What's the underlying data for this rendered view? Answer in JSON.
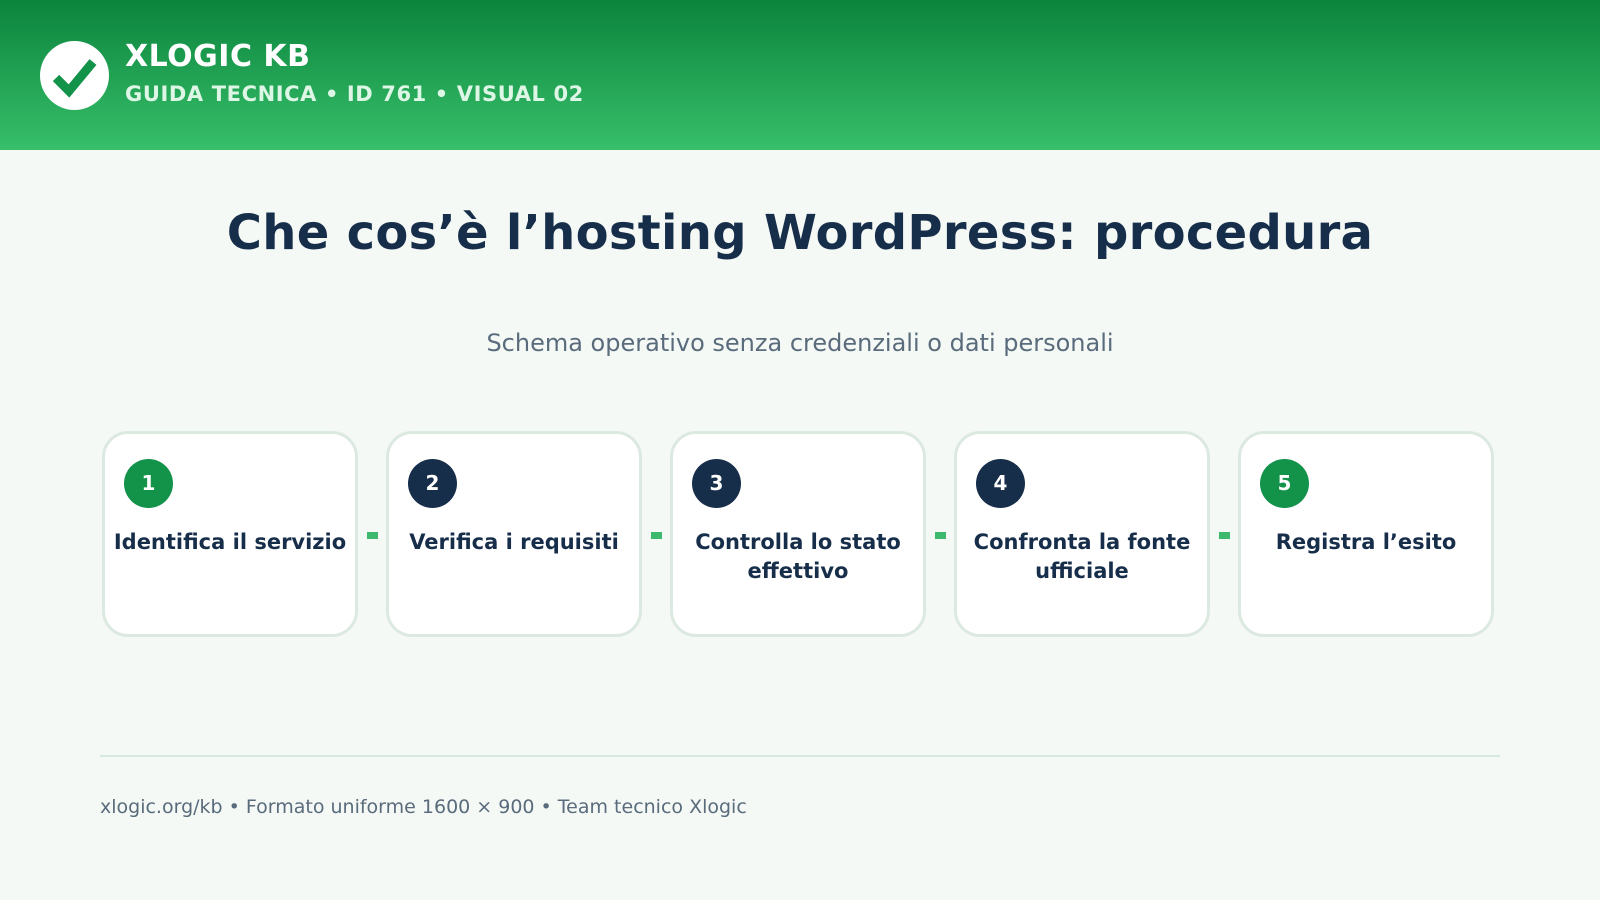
{
  "header": {
    "brand": "XLOGIC KB",
    "tagline": "GUIDA TECNICA • ID 761 • VISUAL 02",
    "logo_icon": "check-icon",
    "colors": {
      "top": "#0b843c",
      "bottom": "#37bf6a"
    }
  },
  "main": {
    "title": "Che cos’è l’hosting WordPress: procedura",
    "subtitle": "Schema operativo senza credenziali o dati personali",
    "steps": [
      {
        "number": "1",
        "label": "Identifica il servizio",
        "color": "#13924a"
      },
      {
        "number": "2",
        "label": "Verifica i requisiti",
        "color": "#172e4a"
      },
      {
        "number": "3",
        "label": "Controlla lo stato effettivo",
        "color": "#172e4a"
      },
      {
        "number": "4",
        "label": "Confronta la fonte ufficiale",
        "color": "#172e4a"
      },
      {
        "number": "5",
        "label": "Registra l’esito",
        "color": "#13924a"
      }
    ]
  },
  "footer": {
    "text": "xlogic.org/kb • Formato uniforme 1600 × 900 • Team tecnico Xlogic"
  }
}
